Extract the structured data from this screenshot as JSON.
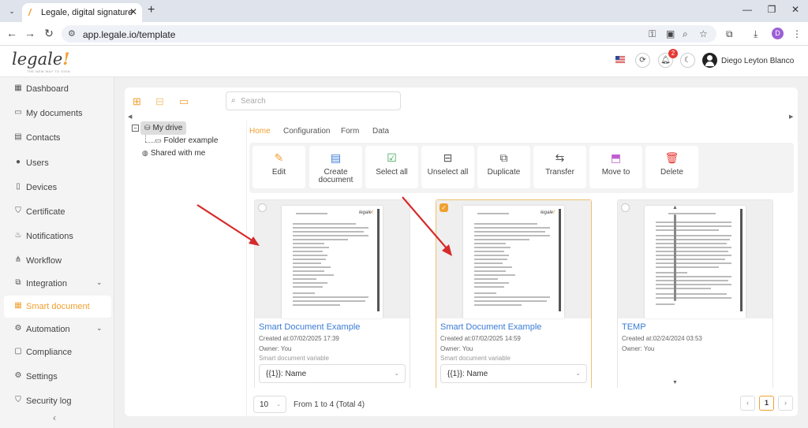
{
  "browser": {
    "tab_title": "Legale, digital signature",
    "url": "app.legale.io/template",
    "profile_initial": "D"
  },
  "header": {
    "logo_text": "legale",
    "logo_tagline": "THE NEW WAY TO SIGN",
    "notification_count": "2",
    "user_name": "Diego Leyton Blanco"
  },
  "sidebar": {
    "items": [
      {
        "label": "Dashboard",
        "icon": "dashboard-icon"
      },
      {
        "label": "My documents",
        "icon": "folder-icon"
      },
      {
        "label": "Contacts",
        "icon": "contacts-icon"
      },
      {
        "label": "Users",
        "icon": "user-icon"
      },
      {
        "label": "Devices",
        "icon": "device-icon"
      },
      {
        "label": "Certificate",
        "icon": "shield-check-icon"
      },
      {
        "label": "Notifications",
        "icon": "bell-icon"
      },
      {
        "label": "Workflow",
        "icon": "workflow-icon"
      },
      {
        "label": "Integration",
        "icon": "integration-icon"
      },
      {
        "label": "Smart document",
        "icon": "smart-document-icon"
      },
      {
        "label": "Automation",
        "icon": "automation-icon"
      },
      {
        "label": "Compliance",
        "icon": "compliance-icon"
      },
      {
        "label": "Settings",
        "icon": "gear-icon"
      },
      {
        "label": "Security log",
        "icon": "security-icon"
      }
    ],
    "active_index": 9,
    "accent": "#f0a030"
  },
  "toolbar": {
    "search_placeholder": "Search"
  },
  "tree": {
    "root": "My drive",
    "child": "Folder example",
    "shared": "Shared with me"
  },
  "tabs": [
    "Home",
    "Configuration",
    "Form",
    "Data"
  ],
  "actions": [
    {
      "label": "Edit",
      "icon": "pencil-icon"
    },
    {
      "label": "Create document",
      "icon": "create-document-icon"
    },
    {
      "label": "Select all",
      "icon": "select-all-icon"
    },
    {
      "label": "Unselect all",
      "icon": "unselect-all-icon"
    },
    {
      "label": "Duplicate",
      "icon": "duplicate-icon"
    },
    {
      "label": "Transfer",
      "icon": "transfer-icon"
    },
    {
      "label": "Move to",
      "icon": "move-to-icon"
    },
    {
      "label": "Delete",
      "icon": "trash-icon"
    }
  ],
  "documents": [
    {
      "title": "Smart Document Example",
      "created": "Created at:07/02/2025 17:39",
      "owner": "Owner: You",
      "variable_label": "Smart document variable",
      "variable_value": "{{1}}: Name",
      "selected": false
    },
    {
      "title": "Smart Document Example",
      "created": "Created at:07/02/2025 14:59",
      "owner": "Owner: You",
      "variable_label": "Smart document variable",
      "variable_value": "{{1}}: Name",
      "selected": true
    },
    {
      "title": "TEMP",
      "created": "Created at:02/24/2024 03:53",
      "owner": "Owner: You",
      "selected": false
    }
  ],
  "pagination": {
    "page_size": "10",
    "range_text": "From 1 to 4 (Total 4)",
    "current_page": "1"
  }
}
